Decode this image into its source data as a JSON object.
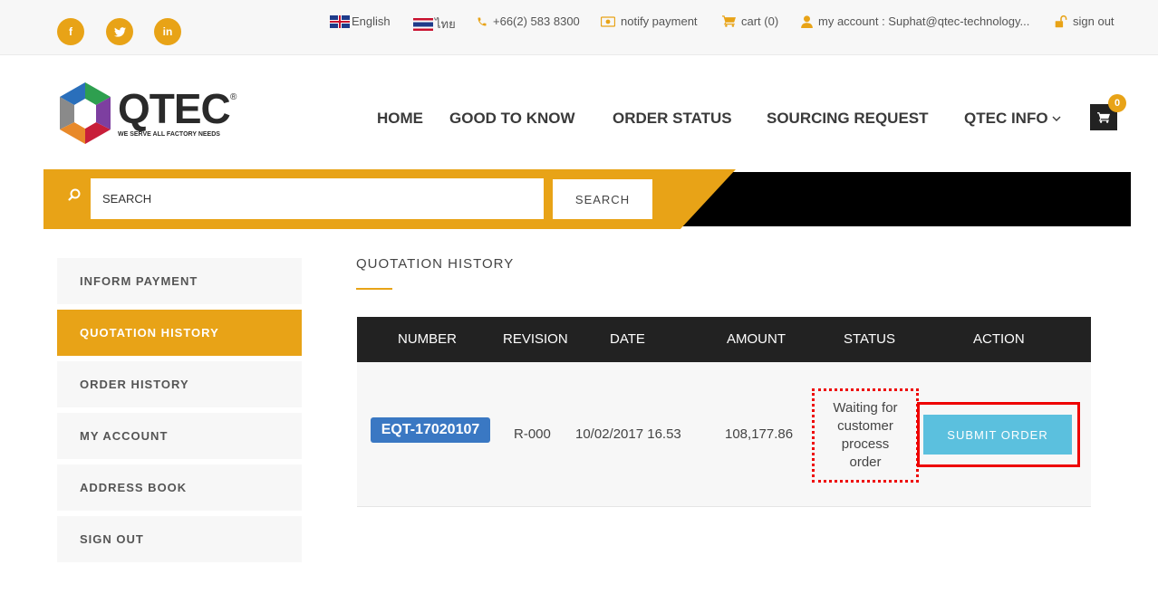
{
  "topbar": {
    "social": [
      {
        "name": "facebook-icon",
        "glyph": "f"
      },
      {
        "name": "twitter-icon",
        "glyph": "t"
      },
      {
        "name": "linkedin-icon",
        "glyph": "in"
      }
    ],
    "lang_en": "English",
    "lang_th": "ไทย",
    "phone": "+66(2) 583 8300",
    "notify_payment": "notify payment",
    "cart": "cart (0)",
    "account": "my account : Suphat@qtec-technology...",
    "sign_out": "sign out"
  },
  "header": {
    "logo_word": "QTEC",
    "logo_reg": "®",
    "logo_tagline": "WE SERVE ALL FACTORY NEEDS",
    "nav": {
      "home": "HOME",
      "good_to_know": "GOOD TO KNOW",
      "order_status": "ORDER STATUS",
      "sourcing_request": "SOURCING REQUEST",
      "qtec_info": "QTEC INFO"
    },
    "cart_count": "0"
  },
  "search": {
    "placeholder": "SEARCH",
    "button_label": "SEARCH"
  },
  "sidebar": {
    "items": [
      {
        "label": "INFORM PAYMENT",
        "active": false
      },
      {
        "label": "QUOTATION HISTORY",
        "active": true
      },
      {
        "label": "ORDER HISTORY",
        "active": false
      },
      {
        "label": "MY ACCOUNT",
        "active": false
      },
      {
        "label": "ADDRESS BOOK",
        "active": false
      },
      {
        "label": "SIGN OUT",
        "active": false
      }
    ]
  },
  "main": {
    "title": "QUOTATION HISTORY",
    "table": {
      "headers": {
        "number": "NUMBER",
        "revision": "REVISION",
        "date": "DATE",
        "amount": "AMOUNT",
        "status": "STATUS",
        "action": "ACTION"
      },
      "rows": [
        {
          "number": "EQT-17020107",
          "revision": "R-000",
          "date": "10/02/2017 16.53",
          "amount": "108,177.86",
          "status": "Waiting for customer process order",
          "action": "SUBMIT ORDER"
        }
      ]
    }
  },
  "colors": {
    "accent": "#e8a317",
    "dark": "#222222",
    "button_blue": "#5bc0de",
    "badge_blue": "#3a78c3",
    "highlight_red": "#e00000"
  }
}
